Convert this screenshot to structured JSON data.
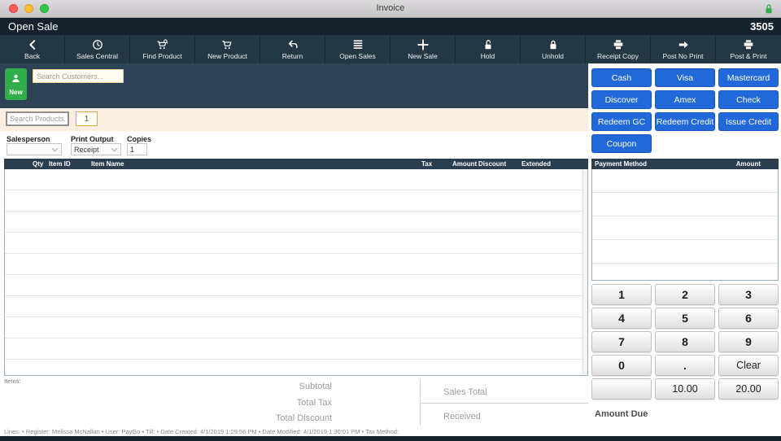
{
  "window": {
    "title": "Invoice"
  },
  "header": {
    "title": "Open Sale",
    "sale_number": "3505"
  },
  "toolbar": {
    "buttons": [
      {
        "label": "Back",
        "icon": "back-icon"
      },
      {
        "label": "Sales Central",
        "icon": "clock-icon"
      },
      {
        "label": "Find Product",
        "icon": "cart-search-icon"
      },
      {
        "label": "New Product",
        "icon": "cart-icon"
      },
      {
        "label": "Return",
        "icon": "return-arrow-icon"
      },
      {
        "label": "Open Sales",
        "icon": "list-icon"
      },
      {
        "label": "New Sale",
        "icon": "plus-icon"
      },
      {
        "label": "Hold",
        "icon": "unlock-icon"
      },
      {
        "label": "Unhold",
        "icon": "lock-icon"
      },
      {
        "label": "Receipt Copy",
        "icon": "printer-icon"
      },
      {
        "label": "Post No Print",
        "icon": "arrow-right-icon"
      },
      {
        "label": "Post & Print",
        "icon": "printer-icon"
      }
    ]
  },
  "customer": {
    "new_button": "New",
    "search_placeholder": "Search Customers..."
  },
  "payment_buttons": [
    "Cash",
    "Visa",
    "Mastercard",
    "Discover",
    "Amex",
    "Check",
    "Redeem GC",
    "Redeem Credit",
    "Issue Credit",
    "Coupon"
  ],
  "product_search": {
    "placeholder": "Search Products...",
    "quantity": "1"
  },
  "sale_options": {
    "salesperson_label": "Salesperson",
    "salesperson_value": "",
    "print_output_label": "Print Output",
    "print_output_value": "Receipt",
    "copies_label": "Copies",
    "copies_value": "1"
  },
  "items_table": {
    "columns": [
      "Qty",
      "Item ID",
      "Item Name",
      "Tax",
      "Amount",
      "Discount",
      "Extended"
    ],
    "rows": [],
    "footer_label": "Items:"
  },
  "payment_table": {
    "columns": [
      "Payment Method",
      "Amount"
    ],
    "rows": []
  },
  "numpad": {
    "keys": [
      [
        "1",
        "2",
        "3"
      ],
      [
        "4",
        "5",
        "6"
      ],
      [
        "7",
        "8",
        "9"
      ],
      [
        "0",
        ".",
        "Clear"
      ],
      [
        "",
        "10.00",
        "20.00"
      ]
    ]
  },
  "totals": {
    "subtotal_label": "Subtotal",
    "total_tax_label": "Total Tax",
    "total_discount_label": "Total Discount",
    "sales_total_label": "Sales Total",
    "received_label": "Received",
    "amount_due_label": "Amount Due"
  },
  "status_bar": {
    "text": "Lines:  • Register: Melissa McNallan • User: PayGo • Till:  • Date Created: 4/1/2019 1:29:56 PM • Date Modified: 4/1/2019 1:30:01 PM • Tax Method:"
  },
  "colors": {
    "header_navy": "#15212d",
    "toolbar_navy": "#243745",
    "panel_navy": "#2d4254",
    "table_header_navy": "#2b3e50",
    "accent_green": "#2fae49",
    "accent_blue": "#2169d8",
    "cream_band": "#fcefe1"
  }
}
